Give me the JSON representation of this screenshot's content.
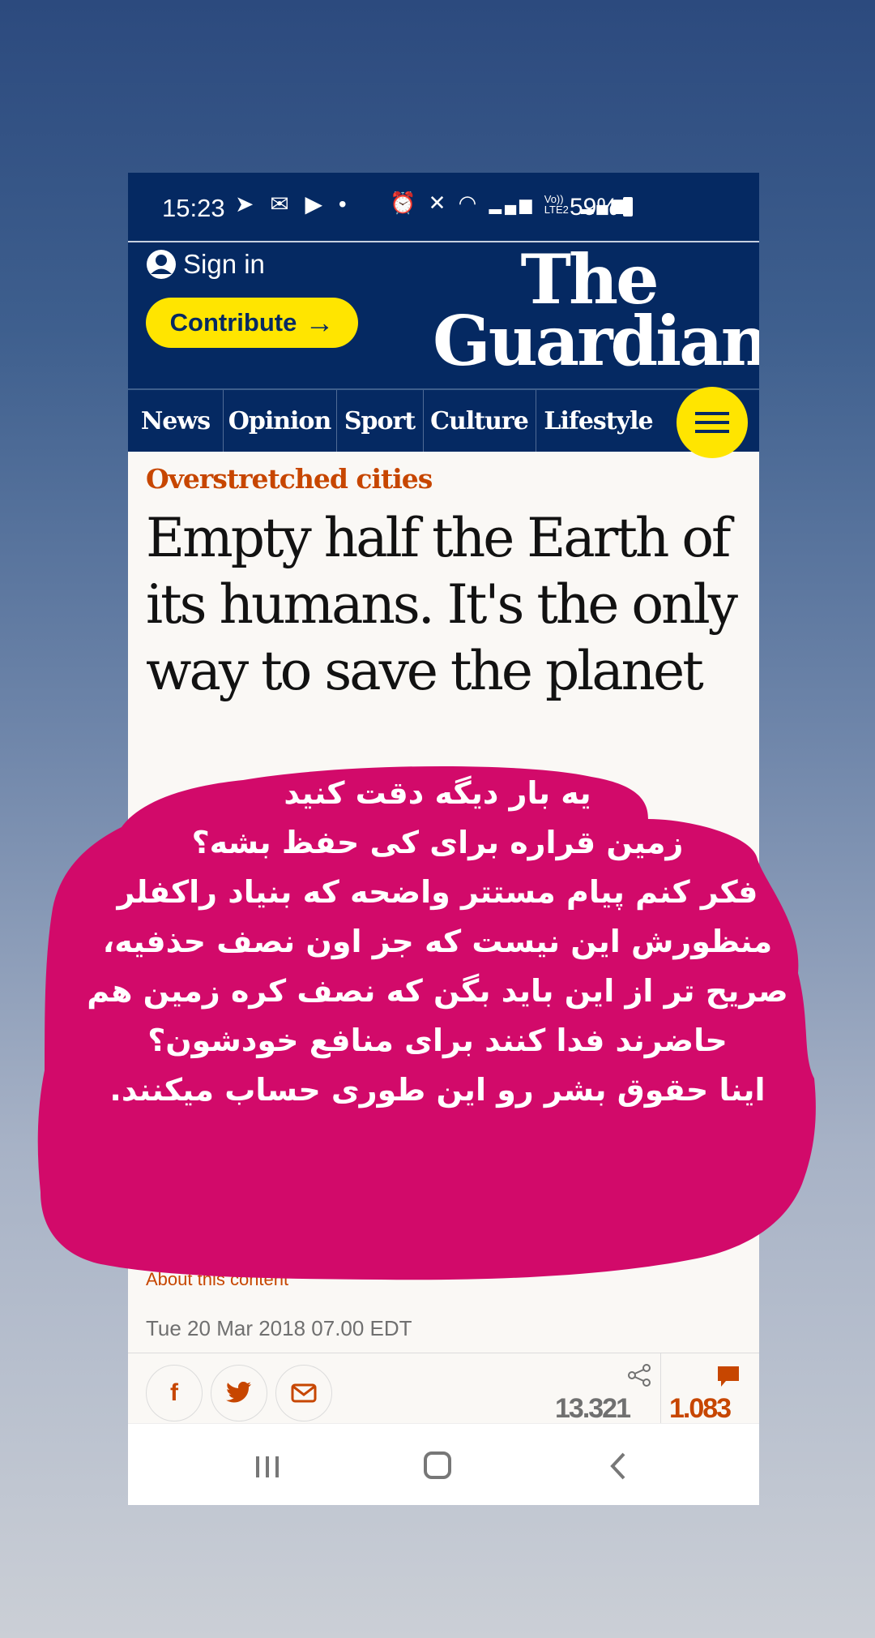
{
  "status_bar": {
    "time": "15:23",
    "battery": "59%",
    "left_icons": [
      "telegram-icon",
      "gmail-icon",
      "play-store-icon",
      "dot-icon"
    ],
    "right_icons": [
      "alarm-icon",
      "mute-icon",
      "wifi-icon",
      "signal-icon",
      "volte-icon",
      "signal-icon",
      "battery-icon"
    ],
    "volte_label": "Vo)) LTE2"
  },
  "header": {
    "signin_label": "Sign in",
    "contribute_label": "Contribute",
    "logo_line1": "The",
    "logo_line2": "Guardian"
  },
  "nav": {
    "items": [
      "News",
      "Opinion",
      "Sport",
      "Culture",
      "Lifestyle"
    ]
  },
  "article": {
    "kicker": "Overstretched cities",
    "headline": "Empty half the Earth of its humans. It's the only way to save the planet",
    "about_label": "About this content",
    "date": "Tue 20 Mar 2018 07.00 EDT",
    "share_count": "13.321",
    "comment_count": "1.083"
  },
  "overlay": {
    "lines": [
      "یه بار دیگه دقت کنید",
      "زمین قراره برای کی حفظ بشه؟",
      "فکر کنم پیام مستتر واضحه که بنیاد راکفلر",
      "منظورش این نیست که جز اون نصف حذفیه،",
      "صریح تر از این باید بگن که نصف کره زمین هم",
      "حاضرند فدا کنند برای منافع خودشون؟",
      "اینا حقوق بشر رو این طوری حساب میکنند."
    ],
    "blob_color": "#d20a6a"
  },
  "colors": {
    "guardian_blue": "#052962",
    "yellow": "#ffe500",
    "kicker_orange": "#c74600"
  }
}
